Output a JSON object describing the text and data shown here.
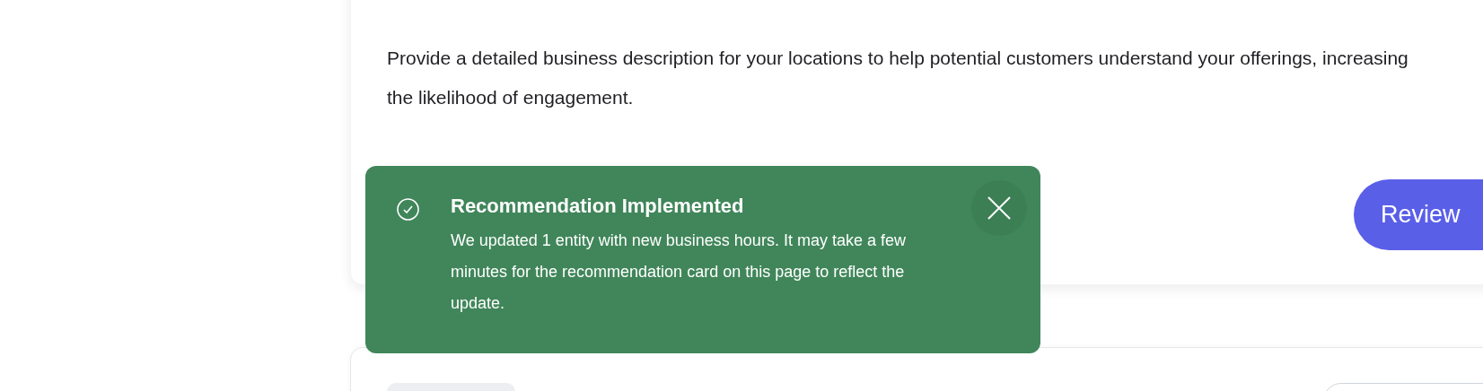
{
  "recommendation_card": {
    "description": "Provide a detailed business description for your locations to help potential customers understand your offerings, increasing the likelihood of engagement.",
    "button": "Review"
  },
  "toast": {
    "title": "Recommendation Implemented",
    "message": "We updated 1 entity with new business hours. It may take a few minutes for the recommendation card on this page to reflect the update."
  }
}
